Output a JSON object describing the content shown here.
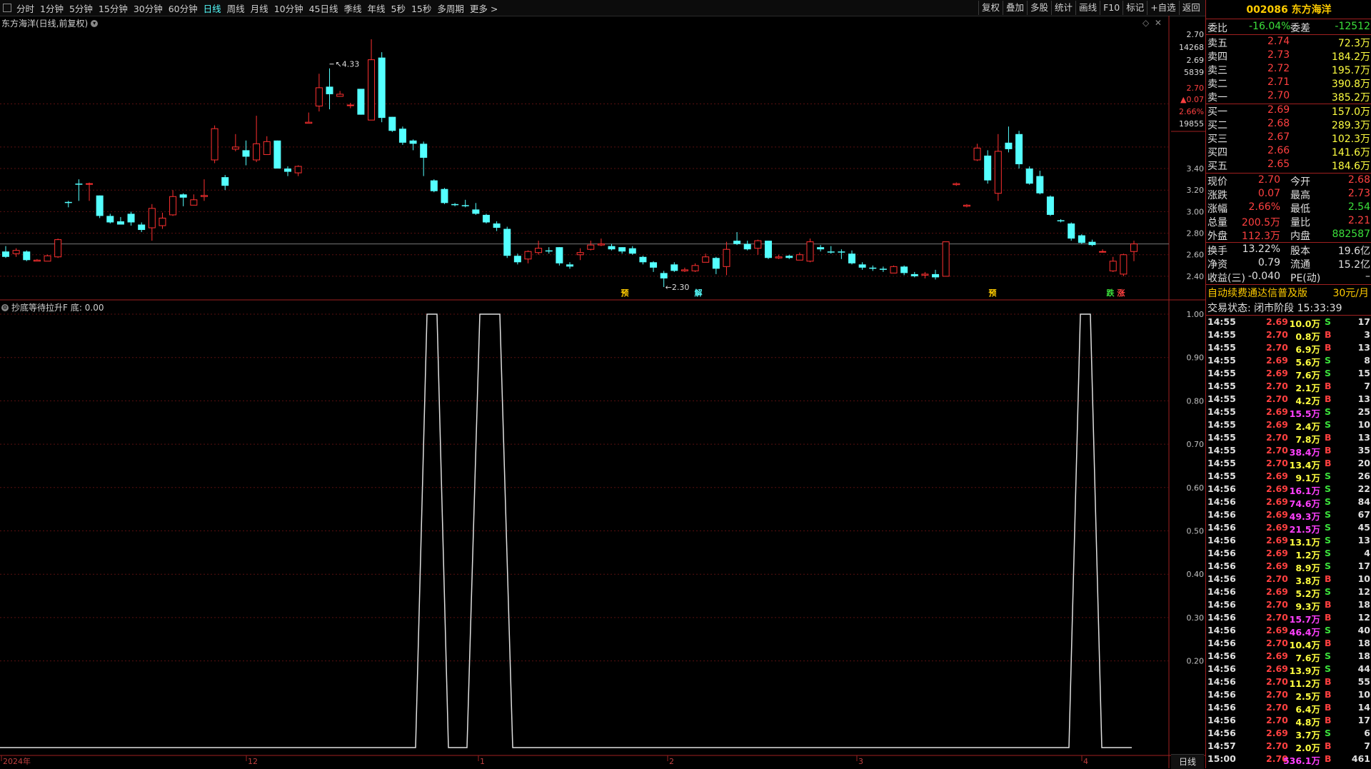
{
  "toolbar": {
    "periods": [
      "分时",
      "1分钟",
      "5分钟",
      "15分钟",
      "30分钟",
      "60分钟",
      "日线",
      "周线",
      "月线",
      "10分钟",
      "45日线",
      "季线",
      "年线",
      "5秒",
      "15秒",
      "多周期",
      "更多 >"
    ],
    "active_period": "日线",
    "tools": [
      "复权",
      "叠加",
      "多股",
      "统计",
      "画线",
      "F10",
      "标记",
      "+自选",
      "返回"
    ]
  },
  "chart": {
    "title": "东方海洋(日线,前复权)",
    "high_label": "4.33",
    "low_label": "2.30",
    "markers": [
      "预",
      "解",
      "预",
      "跌",
      "涨"
    ],
    "price_axis": [
      "3.40",
      "3.20",
      "3.00",
      "2.80",
      "2.60",
      "2.40"
    ],
    "cursor_box": [
      "2.70",
      "14268",
      "2.69",
      "5839",
      "2.70",
      "▲0.07",
      "2.66%",
      "19855"
    ]
  },
  "indicator": {
    "title": "抄底等待拉升F",
    "value_label": "底: 0.00",
    "axis": [
      "1.00",
      "0.90",
      "0.80",
      "0.70",
      "0.60",
      "0.50",
      "0.40",
      "0.30",
      "0.20"
    ]
  },
  "time_axis": [
    "2024年",
    "12",
    "1",
    "2",
    "3",
    "4"
  ],
  "bottom_tab": "日线",
  "quote": {
    "code": "002086",
    "name": "东方海洋",
    "weibi_label": "委比",
    "weibi": "-16.04%",
    "weicha_label": "委差",
    "weicha": "-12512",
    "asks": [
      {
        "label": "卖五",
        "price": "2.74",
        "vol": "72.3万"
      },
      {
        "label": "卖四",
        "price": "2.73",
        "vol": "184.2万"
      },
      {
        "label": "卖三",
        "price": "2.72",
        "vol": "195.7万"
      },
      {
        "label": "卖二",
        "price": "2.71",
        "vol": "390.8万"
      },
      {
        "label": "卖一",
        "price": "2.70",
        "vol": "385.2万"
      }
    ],
    "bids": [
      {
        "label": "买一",
        "price": "2.69",
        "vol": "157.0万"
      },
      {
        "label": "买二",
        "price": "2.68",
        "vol": "289.3万"
      },
      {
        "label": "买三",
        "price": "2.67",
        "vol": "102.3万"
      },
      {
        "label": "买四",
        "price": "2.66",
        "vol": "141.6万"
      },
      {
        "label": "买五",
        "price": "2.65",
        "vol": "184.6万"
      }
    ],
    "stats": [
      {
        "l1": "现价",
        "v1": "2.70",
        "l2": "今开",
        "v2": "2.68"
      },
      {
        "l1": "涨跌",
        "v1": "0.07",
        "l2": "最高",
        "v2": "2.73"
      },
      {
        "l1": "涨幅",
        "v1": "2.66%",
        "l2": "最低",
        "v2": "2.54"
      },
      {
        "l1": "总量",
        "v1": "200.5万",
        "l2": "量比",
        "v2": "2.21"
      },
      {
        "l1": "外盘",
        "v1": "112.3万",
        "l2": "内盘",
        "v2": "882587"
      }
    ],
    "stats2": [
      {
        "l1": "换手",
        "v1": "13.22%",
        "l2": "股本",
        "v2": "19.6亿"
      },
      {
        "l1": "净资",
        "v1": "0.79",
        "l2": "流通",
        "v2": "15.2亿"
      },
      {
        "l1": "收益(三)",
        "v1": "-0.040",
        "l2": "PE(动)",
        "v2": "–"
      }
    ],
    "banner_text": "自动续费通达信普及版",
    "banner_price": "30元/月",
    "trade_status": "交易状态: 闭市阶段 15:33:39"
  },
  "ticks": [
    [
      "14:55",
      "2.69",
      "10.0万",
      "S",
      "17"
    ],
    [
      "14:55",
      "2.70",
      "0.8万",
      "B",
      "3"
    ],
    [
      "14:55",
      "2.70",
      "6.9万",
      "B",
      "13"
    ],
    [
      "14:55",
      "2.69",
      "5.6万",
      "S",
      "8"
    ],
    [
      "14:55",
      "2.69",
      "7.6万",
      "S",
      "15"
    ],
    [
      "14:55",
      "2.70",
      "2.1万",
      "B",
      "7"
    ],
    [
      "14:55",
      "2.70",
      "4.2万",
      "B",
      "13"
    ],
    [
      "14:55",
      "2.69",
      "15.5万",
      "S",
      "25"
    ],
    [
      "14:55",
      "2.69",
      "2.4万",
      "S",
      "10"
    ],
    [
      "14:55",
      "2.70",
      "7.8万",
      "B",
      "13"
    ],
    [
      "14:55",
      "2.70",
      "38.4万",
      "B",
      "35"
    ],
    [
      "14:55",
      "2.70",
      "13.4万",
      "B",
      "20"
    ],
    [
      "14:55",
      "2.69",
      "9.1万",
      "S",
      "26"
    ],
    [
      "14:56",
      "2.69",
      "16.1万",
      "S",
      "22"
    ],
    [
      "14:56",
      "2.69",
      "74.6万",
      "S",
      "84"
    ],
    [
      "14:56",
      "2.69",
      "49.3万",
      "S",
      "67"
    ],
    [
      "14:56",
      "2.69",
      "21.5万",
      "S",
      "45"
    ],
    [
      "14:56",
      "2.69",
      "13.1万",
      "S",
      "13"
    ],
    [
      "14:56",
      "2.69",
      "1.2万",
      "S",
      "4"
    ],
    [
      "14:56",
      "2.69",
      "8.9万",
      "S",
      "17"
    ],
    [
      "14:56",
      "2.70",
      "3.8万",
      "B",
      "10"
    ],
    [
      "14:56",
      "2.69",
      "5.2万",
      "S",
      "12"
    ],
    [
      "14:56",
      "2.70",
      "9.3万",
      "B",
      "18"
    ],
    [
      "14:56",
      "2.70",
      "15.7万",
      "B",
      "12"
    ],
    [
      "14:56",
      "2.69",
      "46.4万",
      "S",
      "40"
    ],
    [
      "14:56",
      "2.70",
      "10.4万",
      "B",
      "18"
    ],
    [
      "14:56",
      "2.69",
      "7.6万",
      "S",
      "18"
    ],
    [
      "14:56",
      "2.69",
      "13.9万",
      "S",
      "44"
    ],
    [
      "14:56",
      "2.70",
      "11.2万",
      "B",
      "55"
    ],
    [
      "14:56",
      "2.70",
      "2.5万",
      "B",
      "10"
    ],
    [
      "14:56",
      "2.70",
      "6.4万",
      "B",
      "14"
    ],
    [
      "14:56",
      "2.70",
      "4.8万",
      "B",
      "17"
    ],
    [
      "14:56",
      "2.69",
      "3.7万",
      "S",
      "6"
    ],
    [
      "14:57",
      "2.70",
      "2.0万",
      "B",
      "7"
    ],
    [
      "15:00",
      "2.70",
      "536.1万",
      "B",
      "461"
    ]
  ],
  "candles": [
    [
      2.63,
      2.58,
      2.68,
      2.57
    ],
    [
      2.61,
      2.64,
      2.66,
      2.58
    ],
    [
      2.63,
      2.55,
      2.64,
      2.54
    ],
    [
      2.54,
      2.55,
      2.56,
      2.54
    ],
    [
      2.54,
      2.59,
      2.6,
      2.54
    ],
    [
      2.58,
      2.74,
      2.75,
      2.57
    ],
    [
      3.09,
      3.08,
      3.1,
      3.04
    ],
    [
      3.26,
      3.25,
      3.3,
      3.1
    ],
    [
      3.26,
      3.26,
      3.27,
      3.1
    ],
    [
      3.15,
      2.96,
      3.15,
      2.94
    ],
    [
      2.96,
      2.9,
      2.98,
      2.89
    ],
    [
      2.91,
      2.88,
      2.95,
      2.88
    ],
    [
      2.98,
      2.9,
      3.0,
      2.87
    ],
    [
      2.88,
      2.83,
      2.9,
      2.81
    ],
    [
      2.85,
      3.03,
      3.07,
      2.73
    ],
    [
      2.87,
      2.94,
      2.99,
      2.84
    ],
    [
      2.97,
      3.14,
      3.2,
      2.96
    ],
    [
      3.16,
      3.13,
      3.17,
      3.05
    ],
    [
      3.06,
      3.11,
      3.16,
      3.06
    ],
    [
      3.14,
      3.15,
      3.3,
      3.1
    ],
    [
      3.48,
      3.77,
      3.8,
      3.45
    ],
    [
      3.32,
      3.24,
      3.34,
      3.2
    ],
    [
      3.58,
      3.6,
      3.72,
      3.56
    ],
    [
      3.57,
      3.51,
      3.66,
      3.43
    ],
    [
      3.48,
      3.63,
      3.89,
      3.46
    ],
    [
      3.53,
      3.65,
      3.7,
      3.53
    ],
    [
      3.66,
      3.4,
      3.66,
      3.4
    ],
    [
      3.4,
      3.37,
      3.42,
      3.33
    ],
    [
      3.36,
      3.42,
      3.43,
      3.33
    ],
    [
      3.82,
      3.83,
      3.92,
      3.82
    ],
    [
      3.98,
      4.15,
      4.28,
      3.93
    ],
    [
      4.16,
      4.09,
      4.33,
      3.95
    ],
    [
      4.07,
      4.09,
      4.12,
      4.08
    ],
    [
      3.99,
      3.99,
      4.01,
      3.96
    ],
    [
      4.14,
      3.9,
      4.1,
      3.9
    ],
    [
      3.85,
      4.41,
      4.6,
      3.85
    ],
    [
      4.43,
      3.87,
      4.48,
      3.83
    ],
    [
      3.88,
      3.75,
      3.88,
      3.74
    ],
    [
      3.77,
      3.64,
      3.79,
      3.62
    ],
    [
      3.66,
      3.63,
      3.67,
      3.57
    ],
    [
      3.63,
      3.5,
      3.65,
      3.33
    ],
    [
      3.29,
      3.19,
      3.3,
      3.18
    ],
    [
      3.21,
      3.08,
      3.22,
      3.07
    ],
    [
      3.07,
      3.06,
      3.08,
      3.05
    ],
    [
      3.06,
      3.05,
      3.11,
      3.04
    ],
    [
      3.02,
      2.98,
      3.08,
      2.97
    ],
    [
      2.97,
      2.9,
      2.98,
      2.89
    ],
    [
      2.89,
      2.85,
      2.91,
      2.82
    ],
    [
      2.84,
      2.59,
      2.86,
      2.57
    ],
    [
      2.59,
      2.53,
      2.61,
      2.51
    ],
    [
      2.56,
      2.63,
      2.64,
      2.52
    ],
    [
      2.62,
      2.66,
      2.73,
      2.6
    ],
    [
      2.64,
      2.63,
      2.67,
      2.61
    ],
    [
      2.67,
      2.52,
      2.67,
      2.5
    ],
    [
      2.51,
      2.49,
      2.53,
      2.47
    ],
    [
      2.6,
      2.62,
      2.66,
      2.55
    ],
    [
      2.65,
      2.69,
      2.73,
      2.64
    ],
    [
      2.69,
      2.7,
      2.75,
      2.68
    ],
    [
      2.68,
      2.65,
      2.7,
      2.64
    ],
    [
      2.67,
      2.63,
      2.67,
      2.61
    ],
    [
      2.66,
      2.61,
      2.68,
      2.6
    ],
    [
      2.58,
      2.53,
      2.59,
      2.51
    ],
    [
      2.53,
      2.48,
      2.54,
      2.44
    ],
    [
      2.43,
      2.38,
      2.45,
      2.3
    ],
    [
      2.51,
      2.45,
      2.53,
      2.44
    ],
    [
      2.45,
      2.46,
      2.48,
      2.44
    ],
    [
      2.45,
      2.5,
      2.52,
      2.44
    ],
    [
      2.53,
      2.58,
      2.61,
      2.53
    ],
    [
      2.57,
      2.47,
      2.58,
      2.42
    ],
    [
      2.49,
      2.65,
      2.72,
      2.41
    ],
    [
      2.73,
      2.7,
      2.81,
      2.69
    ],
    [
      2.7,
      2.65,
      2.73,
      2.64
    ],
    [
      2.66,
      2.73,
      2.74,
      2.6
    ],
    [
      2.73,
      2.57,
      2.73,
      2.56
    ],
    [
      2.57,
      2.58,
      2.6,
      2.56
    ],
    [
      2.59,
      2.57,
      2.6,
      2.56
    ],
    [
      2.55,
      2.6,
      2.62,
      2.55
    ],
    [
      2.54,
      2.72,
      2.75,
      2.53
    ],
    [
      2.67,
      2.65,
      2.69,
      2.63
    ],
    [
      2.63,
      2.62,
      2.68,
      2.61
    ],
    [
      2.63,
      2.62,
      2.65,
      2.56
    ],
    [
      2.61,
      2.52,
      2.64,
      2.51
    ],
    [
      2.51,
      2.48,
      2.53,
      2.46
    ],
    [
      2.48,
      2.47,
      2.5,
      2.45
    ],
    [
      2.47,
      2.46,
      2.49,
      2.44
    ],
    [
      2.43,
      2.49,
      2.5,
      2.43
    ],
    [
      2.49,
      2.43,
      2.5,
      2.41
    ],
    [
      2.42,
      2.4,
      2.44,
      2.39
    ],
    [
      2.41,
      2.42,
      2.44,
      2.38
    ],
    [
      2.42,
      2.39,
      2.46,
      2.37
    ],
    [
      2.4,
      2.72,
      2.72,
      2.4
    ],
    [
      3.25,
      3.26,
      3.27,
      3.24
    ],
    [
      3.05,
      3.06,
      3.07,
      3.04
    ],
    [
      3.48,
      3.59,
      3.63,
      3.47
    ],
    [
      3.52,
      3.29,
      3.57,
      3.26
    ],
    [
      3.17,
      3.56,
      3.72,
      3.1
    ],
    [
      3.64,
      3.58,
      3.79,
      3.55
    ],
    [
      3.72,
      3.44,
      3.75,
      3.4
    ],
    [
      3.4,
      3.26,
      3.42,
      3.25
    ],
    [
      3.33,
      3.17,
      3.38,
      3.16
    ],
    [
      3.14,
      2.97,
      3.15,
      2.96
    ],
    [
      2.92,
      2.91,
      2.93,
      2.9
    ],
    [
      2.89,
      2.75,
      2.9,
      2.73
    ],
    [
      2.78,
      2.71,
      2.79,
      2.7
    ],
    [
      2.72,
      2.69,
      2.74,
      2.68
    ],
    [
      2.63,
      2.63,
      2.65,
      2.62
    ],
    [
      2.45,
      2.54,
      2.58,
      2.44
    ],
    [
      2.42,
      2.6,
      2.61,
      2.4
    ],
    [
      2.63,
      2.7,
      2.73,
      2.54
    ]
  ],
  "indicator_signal": [
    [
      0,
      0
    ],
    [
      582,
      0
    ],
    [
      598,
      1
    ],
    [
      612,
      1
    ],
    [
      628,
      0
    ],
    [
      654,
      0
    ],
    [
      672,
      1
    ],
    [
      700,
      1
    ],
    [
      718,
      0
    ],
    [
      1497,
      0
    ],
    [
      1513,
      1
    ],
    [
      1527,
      1
    ],
    [
      1543,
      0
    ],
    [
      1585,
      0
    ]
  ]
}
